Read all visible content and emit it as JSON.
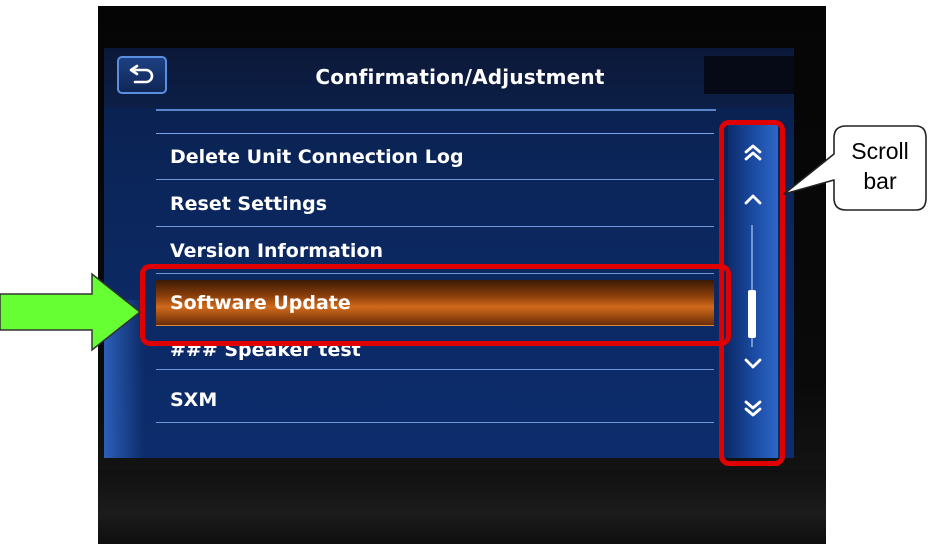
{
  "screen": {
    "title": "Confirmation/Adjustment",
    "back_icon": "back-arrow-icon",
    "menu_items": [
      {
        "label": "Delete Unit Connection Log",
        "selected": false
      },
      {
        "label": "Reset Settings",
        "selected": false
      },
      {
        "label": "Version Information",
        "selected": false
      },
      {
        "label": "Software Update",
        "selected": true
      },
      {
        "label": "### Speaker test",
        "selected": false
      },
      {
        "label": "SXM",
        "selected": false
      }
    ],
    "scrollbar": {
      "icons": [
        "double-chevron-up-icon",
        "chevron-up-icon",
        "chevron-down-icon",
        "double-chevron-down-icon"
      ]
    }
  },
  "annotations": {
    "callout_text_line1": "Scroll",
    "callout_text_line2": "bar",
    "highlight_color": "#e00000",
    "pointer_arrow_color": "#66ff33"
  },
  "colors": {
    "screen_bg": "#0c2a66",
    "selected_item": "#d06a1c",
    "divider": "#6f97da"
  }
}
